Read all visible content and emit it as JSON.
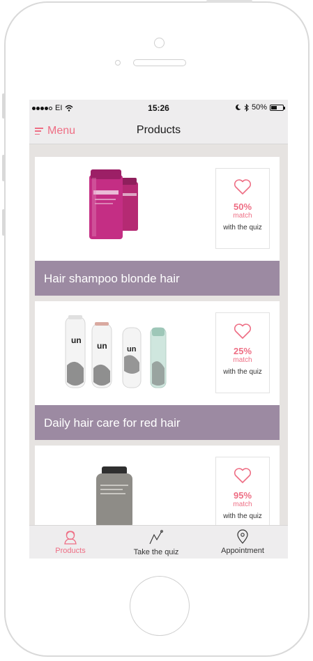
{
  "status_bar": {
    "carrier": "EI",
    "time": "15:26",
    "battery": "50%",
    "battery_level": 0.5
  },
  "nav": {
    "menu_label": "Menu",
    "title": "Products"
  },
  "products": [
    {
      "title": "Hair shampoo blonde hair",
      "match_percent": "50%",
      "match_label": "match",
      "quiz_text": "with the quiz"
    },
    {
      "title": "Daily hair care for red hair",
      "match_percent": "25%",
      "match_label": "match",
      "quiz_text": "with the quiz"
    },
    {
      "title": "",
      "match_percent": "95%",
      "match_label": "match",
      "quiz_text": "with the quiz"
    }
  ],
  "tabs": [
    {
      "label": "Products",
      "icon": "face-icon",
      "active": true
    },
    {
      "label": "Take the quiz",
      "icon": "graph-icon",
      "active": false
    },
    {
      "label": "Appointment",
      "icon": "location-pin-icon",
      "active": false
    }
  ],
  "colors": {
    "accent": "#ee6e84",
    "title_bar": "#9c8aa2",
    "list_background": "#e6e3e1"
  }
}
